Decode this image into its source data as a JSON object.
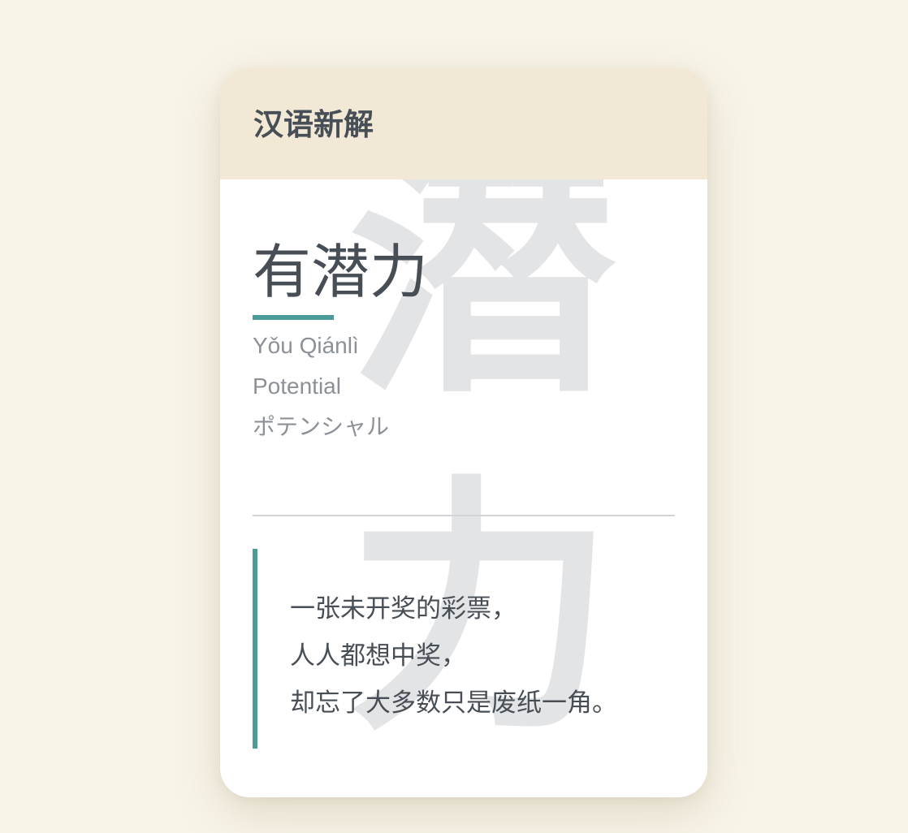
{
  "header": {
    "title": "汉语新解"
  },
  "background_chars": [
    "潜",
    "力"
  ],
  "entry": {
    "term": "有潜力",
    "pinyin": "Yǒu Qiánlì",
    "english": "Potential",
    "japanese": "ポテンシャル"
  },
  "quote": {
    "lines": [
      "一张未开奖的彩票，",
      "人人都想中奖，",
      "却忘了大多数只是废纸一角。"
    ]
  },
  "colors": {
    "page_background": "#f8f4e8",
    "header_background": "#f1e9d6",
    "accent": "#4b9b98",
    "text": "#474e55",
    "muted_text": "#8b9197",
    "watermark": "#e3e4e6"
  }
}
